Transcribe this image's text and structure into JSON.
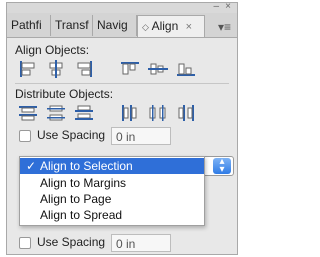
{
  "tabs": [
    {
      "label": "Pathfi"
    },
    {
      "label": "Transf"
    },
    {
      "label": "Navig"
    },
    {
      "label": "Align",
      "active": true,
      "icon": "diamond-icon",
      "close": "×"
    }
  ],
  "window": {
    "minimize": "–",
    "close": "×",
    "menu_icon": "panel-menu-icon"
  },
  "align_objects": {
    "label": "Align Objects:"
  },
  "distribute_objects": {
    "label": "Distribute Objects:"
  },
  "spacing1": {
    "label": "Use Spacing",
    "value": "0 in"
  },
  "spacing2": {
    "label": "Use Spacing",
    "value": "0 in"
  },
  "align_to": {
    "selected_index": 0,
    "options": [
      "Align to Selection",
      "Align to Margins",
      "Align to Page",
      "Align to Spread"
    ]
  },
  "colors": {
    "selection": "#2f6fd8",
    "panel": "#e8e8e8"
  }
}
